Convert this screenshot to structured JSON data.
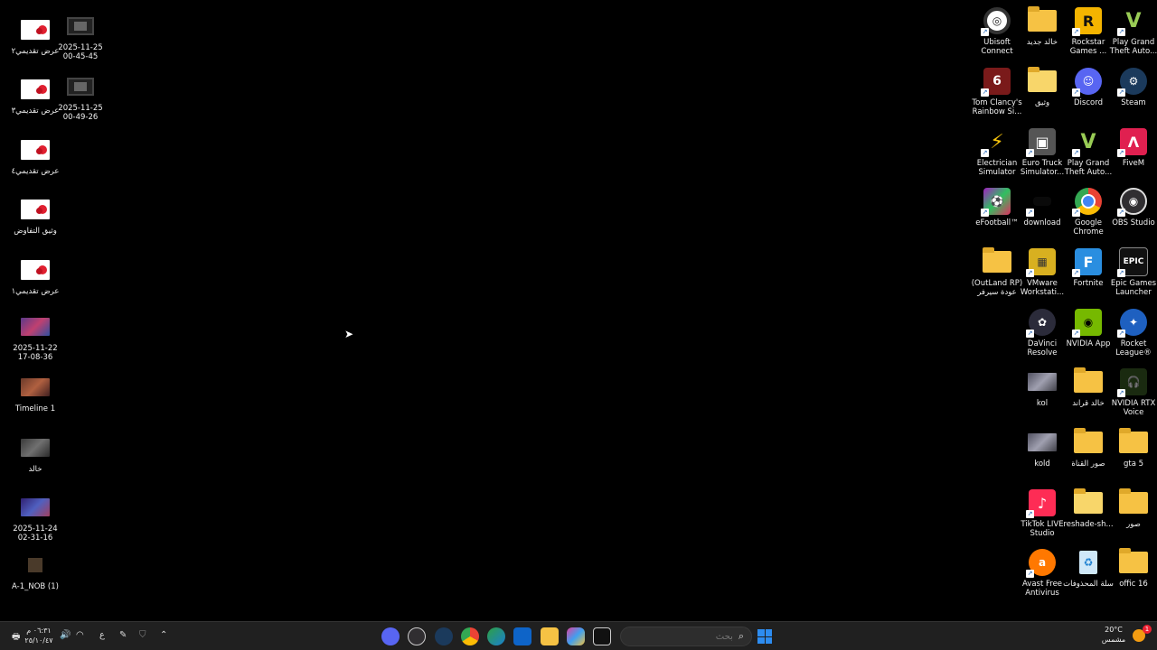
{
  "desktop": {
    "left_icons": [
      {
        "label": "عرض تقديمي٢"
      },
      {
        "label": "2025-11-25 00-45-45"
      },
      {
        "label": "عرض تقديمي٣"
      },
      {
        "label": "2025-11-25 00-49-26"
      },
      {
        "label": "عرض تقديمي٤"
      },
      {
        "label": "وثيق التفاوض"
      },
      {
        "label": "عرض تقديمي١"
      },
      {
        "label": "2025-11-22 17-08-36"
      },
      {
        "label": "Timeline 1"
      },
      {
        "label": "خالد"
      },
      {
        "label": "2025-11-24 02-31-16"
      },
      {
        "label": "A-1_NOB (1)"
      }
    ],
    "right_icons": [
      {
        "label": "Ubisoft Connect",
        "icon": "ubisoft-icon"
      },
      {
        "label": "خالد جديد",
        "icon": "folder-icon"
      },
      {
        "label": "Rockstar Games ...",
        "icon": "rockstar-icon"
      },
      {
        "label": "Play Grand Theft Auto...",
        "icon": "gta-icon"
      },
      {
        "label": "Tom Clancy's Rainbow Si...",
        "icon": "rainbow-six-icon"
      },
      {
        "label": "وثيق",
        "icon": "folder-icon"
      },
      {
        "label": "Discord",
        "icon": "discord-icon"
      },
      {
        "label": "Steam",
        "icon": "steam-icon"
      },
      {
        "label": "Electrician Simulator",
        "icon": "electrician-icon"
      },
      {
        "label": "Euro Truck Simulator...",
        "icon": "truck-icon"
      },
      {
        "label": "Play Grand Theft Auto...",
        "icon": "gta-icon"
      },
      {
        "label": "FiveM",
        "icon": "fivem-icon"
      },
      {
        "label": "eFootball™",
        "icon": "efootball-icon"
      },
      {
        "label": "download",
        "icon": "download-icon"
      },
      {
        "label": "Google Chrome",
        "icon": "chrome-icon"
      },
      {
        "label": "OBS Studio",
        "icon": "obs-icon"
      },
      {
        "label": "(OutLand RP) عودة سيرفر",
        "icon": "folder-icon"
      },
      {
        "label": "VMware Workstati...",
        "icon": "vmware-icon"
      },
      {
        "label": "Fortnite",
        "icon": "fortnite-icon"
      },
      {
        "label": "Epic Games Launcher",
        "icon": "epic-icon"
      },
      {
        "label": "DaVinci Resolve",
        "icon": "davinci-icon"
      },
      {
        "label": "NVIDIA App",
        "icon": "nvidia-icon"
      },
      {
        "label": "Rocket League®",
        "icon": "rocket-league-icon"
      },
      {
        "label": "kol",
        "icon": "video-icon"
      },
      {
        "label": "خالد قراند",
        "icon": "folder-icon"
      },
      {
        "label": "NVIDIA RTX Voice",
        "icon": "rtx-voice-icon"
      },
      {
        "label": "kold",
        "icon": "video-icon"
      },
      {
        "label": "صور القناة",
        "icon": "folder-icon"
      },
      {
        "label": "gta 5",
        "icon": "folder-icon"
      },
      {
        "label": "TikTok LIVE Studio",
        "icon": "tiktok-icon"
      },
      {
        "label": "reshade-sh...",
        "icon": "folder-icon"
      },
      {
        "label": "صور",
        "icon": "folder-icon"
      },
      {
        "label": "Avast Free Antivirus",
        "icon": "avast-icon"
      },
      {
        "label": "سلة المحذوفات",
        "icon": "recycle-bin-icon"
      },
      {
        "label": "offic 16",
        "icon": "folder-icon"
      }
    ]
  },
  "taskbar": {
    "search_placeholder": "بحث",
    "weather_temp": "20°C",
    "weather_desc": "مشمس",
    "notification_count": "1",
    "clock_time": "٠٦:٣١ م",
    "clock_date": "٢٥/١٠/٤٧",
    "lang": "ع",
    "apps": [
      "discord",
      "obs",
      "steam",
      "chrome",
      "edge",
      "store",
      "file-explorer",
      "copilot",
      "terminal"
    ]
  },
  "colors": {
    "desktop_bg": "#000000",
    "taskbar_bg": "#202020",
    "accent": "#2d8cf0"
  }
}
